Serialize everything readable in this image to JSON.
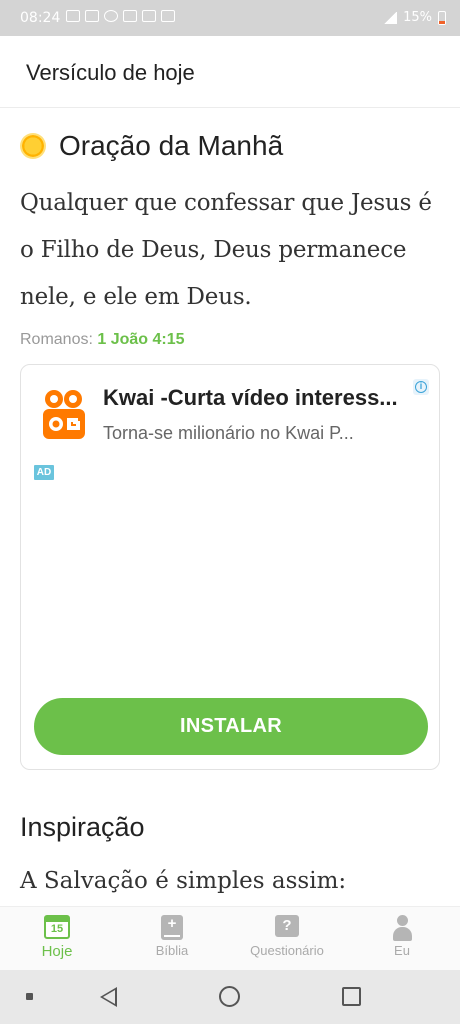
{
  "status_bar": {
    "time": "08:24",
    "battery_percent": "15%",
    "icons": [
      "notification-icon",
      "image-icon",
      "facebook-icon",
      "youtube-icon",
      "mail-icon",
      "calendar-icon"
    ]
  },
  "header": {
    "title": "Versículo de hoje"
  },
  "prayer": {
    "icon": "sun-icon",
    "title": "Oração da Manhã",
    "verse": "Qualquer que confessar que Jesus é o Filho de Deus, Deus permanece nele, e ele em Deus.",
    "reference_prefix": "Romanos:",
    "reference": "1 João 4:15"
  },
  "ad": {
    "app_name": "Kwai -Curta vídeo interess...",
    "description": "Torna-se milionário no Kwai P...",
    "badge": "AD",
    "install_label": "INSTALAR",
    "accent_color": "#6cc04a"
  },
  "inspiration": {
    "title": "Inspiração",
    "text": "A Salvação é simples assim:"
  },
  "bottom_nav": {
    "items": [
      {
        "label": "Hoje",
        "icon": "calendar-icon",
        "active": true,
        "day": "15"
      },
      {
        "label": "Bíblia",
        "icon": "bible-icon",
        "active": false
      },
      {
        "label": "Questionário",
        "icon": "quiz-icon",
        "active": false
      },
      {
        "label": "Eu",
        "icon": "profile-icon",
        "active": false
      }
    ]
  },
  "system_nav": {
    "buttons": [
      "back-icon",
      "home-icon",
      "recent-apps-icon"
    ]
  }
}
